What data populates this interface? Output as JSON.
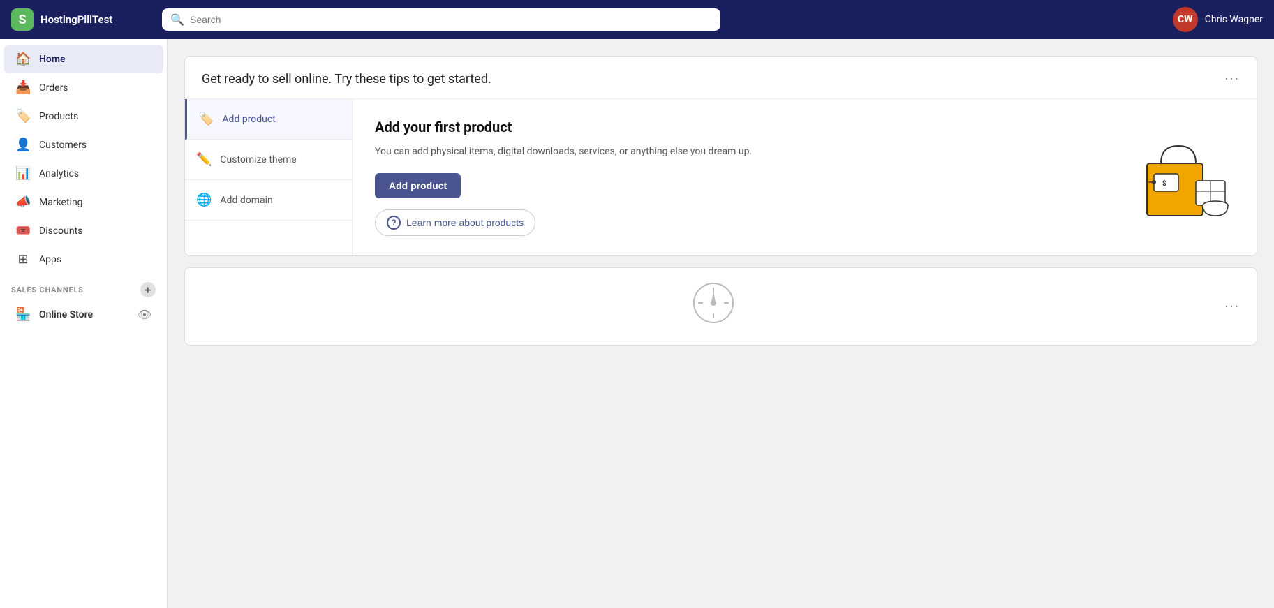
{
  "topbar": {
    "brand": "HostingPillTest",
    "search_placeholder": "Search",
    "user_initials": "CW",
    "user_name": "Chris Wagner"
  },
  "sidebar": {
    "items": [
      {
        "id": "home",
        "label": "Home",
        "icon": "🏠",
        "active": true
      },
      {
        "id": "orders",
        "label": "Orders",
        "icon": "📥",
        "active": false
      },
      {
        "id": "products",
        "label": "Products",
        "icon": "🏷️",
        "active": false
      },
      {
        "id": "customers",
        "label": "Customers",
        "icon": "👤",
        "active": false
      },
      {
        "id": "analytics",
        "label": "Analytics",
        "icon": "📊",
        "active": false
      },
      {
        "id": "marketing",
        "label": "Marketing",
        "icon": "📣",
        "active": false
      },
      {
        "id": "discounts",
        "label": "Discounts",
        "icon": "🎟️",
        "active": false
      },
      {
        "id": "apps",
        "label": "Apps",
        "icon": "⊞",
        "active": false
      }
    ],
    "sales_channels_label": "SALES CHANNELS",
    "online_store_label": "Online Store"
  },
  "card1": {
    "title": "Get ready to sell online. Try these tips to get started.",
    "tips": [
      {
        "id": "add-product",
        "label": "Add product",
        "icon": "🏷️",
        "active": true
      },
      {
        "id": "customize-theme",
        "label": "Customize theme",
        "icon": "✏️",
        "active": false
      },
      {
        "id": "add-domain",
        "label": "Add domain",
        "icon": "🌐",
        "active": false
      }
    ],
    "detail": {
      "heading": "Add your first product",
      "body": "You can add physical items, digital downloads, services, or anything else you dream up.",
      "cta_label": "Add product",
      "learn_more_label": "Learn more about products"
    }
  },
  "card2": {
    "three_dots": "···"
  }
}
